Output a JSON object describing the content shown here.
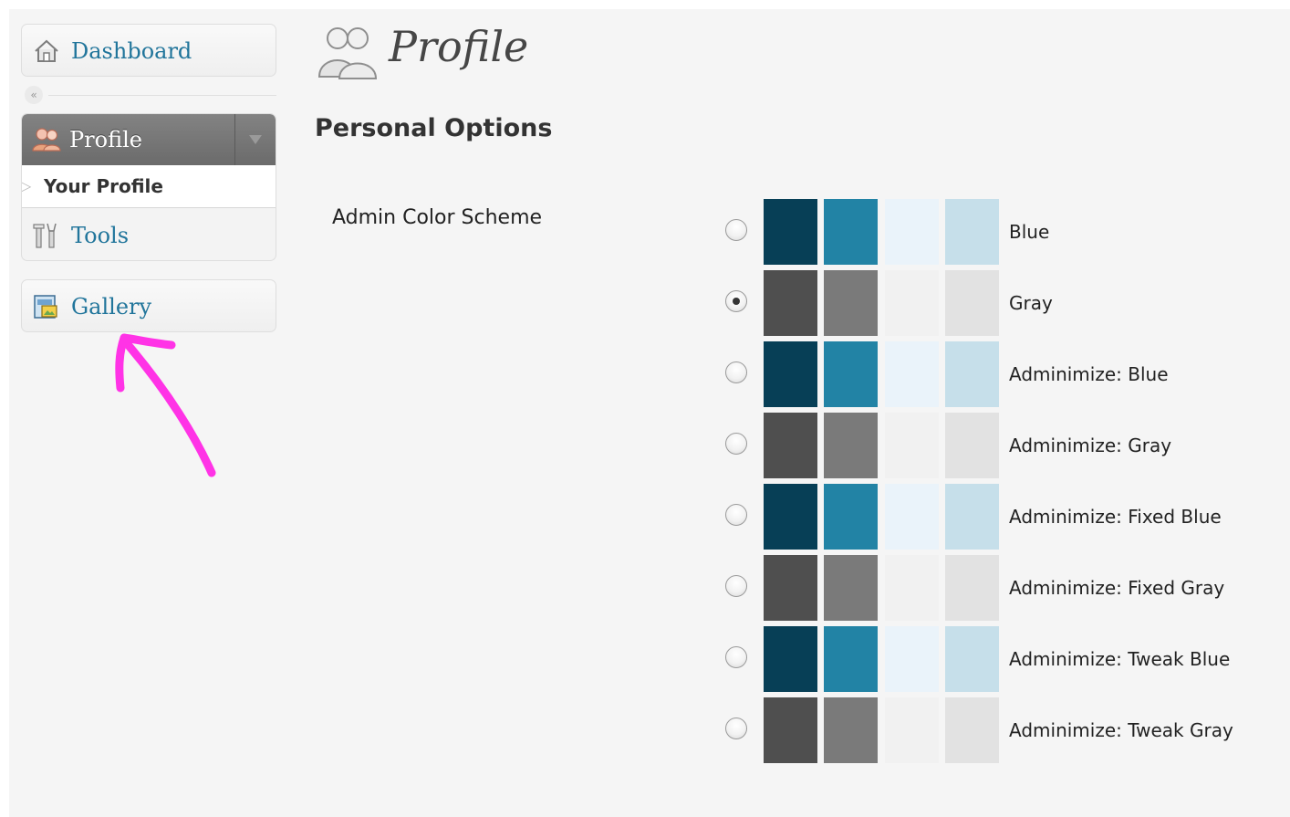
{
  "sidebar": {
    "dashboard": {
      "label": "Dashboard",
      "icon": "house-icon"
    },
    "collapse": {
      "icon": "double-chevron-left-icon",
      "glyph": "«"
    },
    "profile": {
      "label": "Profile",
      "icon": "users-icon",
      "submenu": [
        {
          "label": "Your Profile"
        }
      ],
      "tools": {
        "label": "Tools",
        "icon": "tools-icon"
      }
    },
    "gallery": {
      "label": "Gallery",
      "icon": "gallery-icon"
    }
  },
  "page": {
    "title": "Profile",
    "icon": "users-icon",
    "section_title": "Personal Options",
    "field_label": "Admin Color Scheme"
  },
  "color_schemes": [
    {
      "label": "Blue",
      "selected": false,
      "colors": [
        "#073f56",
        "#2283a5",
        "#eaf3fa",
        "#c6dfea"
      ]
    },
    {
      "label": "Gray",
      "selected": true,
      "colors": [
        "#4f4f4f",
        "#7a7a7a",
        "#f1f1f1",
        "#e2e2e2"
      ]
    },
    {
      "label": "Adminimize: Blue",
      "selected": false,
      "colors": [
        "#073f56",
        "#2283a5",
        "#eaf3fa",
        "#c6dfea"
      ]
    },
    {
      "label": "Adminimize: Gray",
      "selected": false,
      "colors": [
        "#4f4f4f",
        "#7a7a7a",
        "#f1f1f1",
        "#e2e2e2"
      ]
    },
    {
      "label": "Adminimize: Fixed Blue",
      "selected": false,
      "colors": [
        "#073f56",
        "#2283a5",
        "#eaf3fa",
        "#c6dfea"
      ]
    },
    {
      "label": "Adminimize: Fixed Gray",
      "selected": false,
      "colors": [
        "#4f4f4f",
        "#7a7a7a",
        "#f1f1f1",
        "#e2e2e2"
      ]
    },
    {
      "label": "Adminimize: Tweak Blue",
      "selected": false,
      "colors": [
        "#073f56",
        "#2283a5",
        "#eaf3fa",
        "#c6dfea"
      ]
    },
    {
      "label": "Adminimize: Tweak Gray",
      "selected": false,
      "colors": [
        "#4f4f4f",
        "#7a7a7a",
        "#f1f1f1",
        "#e2e2e2"
      ]
    }
  ],
  "annotation": {
    "color": "#ff33e6",
    "icon": "hand-drawn-arrow-icon"
  },
  "colors": {
    "link": "#21759b",
    "active_menu": "#777777"
  }
}
